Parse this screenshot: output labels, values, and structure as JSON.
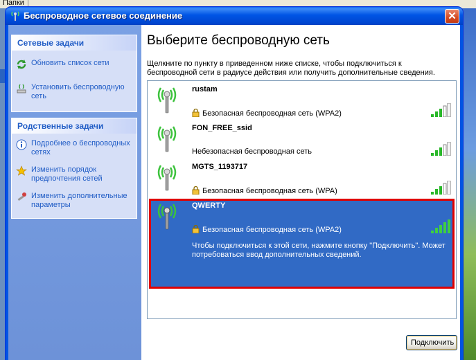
{
  "desktop": {
    "toolbar_fragment": "Папки"
  },
  "window": {
    "title": "Беспроводное сетевое соединение",
    "close_label": "✕"
  },
  "network_tasks": {
    "title": "Сетевые задачи",
    "items": [
      {
        "label": "Обновить список сети",
        "icon": "refresh-icon"
      },
      {
        "label": "Установить беспроводную сеть",
        "icon": "wireless-setup-icon"
      }
    ]
  },
  "related_tasks": {
    "title": "Родственные задачи",
    "items": [
      {
        "label": "Подробнее о беспроводных сетях",
        "icon": "info-icon"
      },
      {
        "label": "Изменить порядок предпочтения сетей",
        "icon": "star-icon"
      },
      {
        "label": "Изменить дополнительные параметры",
        "icon": "settings-icon"
      }
    ]
  },
  "main": {
    "title": "Выберите беспроводную сеть",
    "description": "Щелкните по пункту в приведенном ниже списке, чтобы подключиться к беспроводной сети в радиусе действия или получить дополнительные сведения."
  },
  "networks": [
    {
      "ssid": "rustam",
      "security": "Безопасная беспроводная сеть (WPA2)",
      "secured": true,
      "signal_bars": 3,
      "selected": false
    },
    {
      "ssid": "FON_FREE_ssid",
      "security": "Небезопасная беспроводная сеть",
      "secured": false,
      "signal_bars": 3,
      "selected": false
    },
    {
      "ssid": "MGTS_1193717",
      "security": "Безопасная беспроводная сеть (WPA)",
      "secured": true,
      "signal_bars": 3,
      "selected": false
    },
    {
      "ssid": "QWERTY",
      "security": "Безопасная беспроводная сеть (WPA2)",
      "secured": true,
      "signal_bars": 5,
      "selected": true,
      "hint": "Чтобы подключиться к этой сети, нажмите кнопку \"Подключить\". Может потребоваться ввод дополнительных сведений."
    }
  ],
  "connect_button": "Подключить",
  "colors": {
    "selection": "#316ac5",
    "highlight_border": "#e00000",
    "task_link": "#215dc6"
  }
}
